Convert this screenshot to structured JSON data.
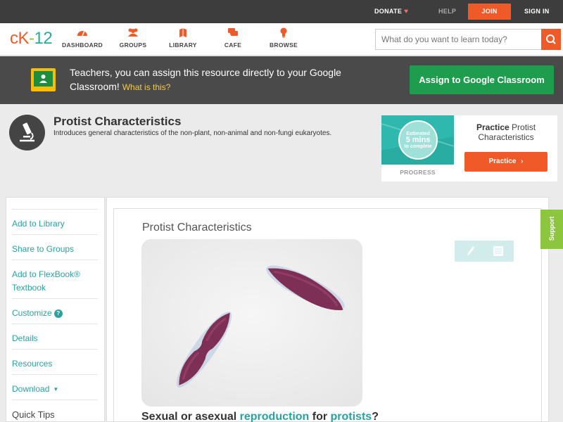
{
  "topbar": {
    "donate": "DONATE",
    "help": "HELP",
    "join": "JOIN",
    "sign_in": "SIGN IN"
  },
  "logo": {
    "text": "CK-12"
  },
  "nav": {
    "items": [
      {
        "label": "DASHBOARD",
        "icon": "dashboard-icon"
      },
      {
        "label": "GROUPS",
        "icon": "groups-icon"
      },
      {
        "label": "LIBRARY",
        "icon": "library-icon"
      },
      {
        "label": "CAFE",
        "icon": "cafe-icon"
      },
      {
        "label": "BROWSE",
        "icon": "browse-icon"
      }
    ],
    "search_placeholder": "What do you want to learn today?"
  },
  "banner": {
    "text": "Teachers, you can assign this resource directly to your Google Classroom!",
    "link": "What is this?",
    "button": "Assign to Google Classroom"
  },
  "concept": {
    "title": "Protist Characteristics",
    "description": "Introduces general characteristics of the non-plant, non-animal and non-fungi eukaryotes."
  },
  "practice": {
    "estimate_line1": "Estimated",
    "estimate_line2": "5 mins",
    "estimate_line3": "to complete",
    "progress_label": "PROGRESS",
    "title_bold": "Practice",
    "title_rest": "Protist Characteristics",
    "button": "Practice"
  },
  "sidebar": {
    "items": [
      {
        "label": "Add to Library"
      },
      {
        "label": "Share to Groups"
      },
      {
        "label": "Add to FlexBook® Textbook"
      },
      {
        "label": "Customize"
      },
      {
        "label": "Details"
      },
      {
        "label": "Resources"
      },
      {
        "label": "Download"
      }
    ],
    "quick_tips": "Quick Tips"
  },
  "content": {
    "title": "Protist Characteristics",
    "subhead_pre": "Sexual or asexual ",
    "subhead_link1": "reproduction",
    "subhead_mid": " for ",
    "subhead_link2": "protists",
    "subhead_post": "?"
  },
  "support": {
    "label": "Support"
  },
  "colors": {
    "accent_orange": "#f05a28",
    "teal": "#2aa1a0",
    "green": "#1e9d4f",
    "support_green": "#8cc63f"
  }
}
